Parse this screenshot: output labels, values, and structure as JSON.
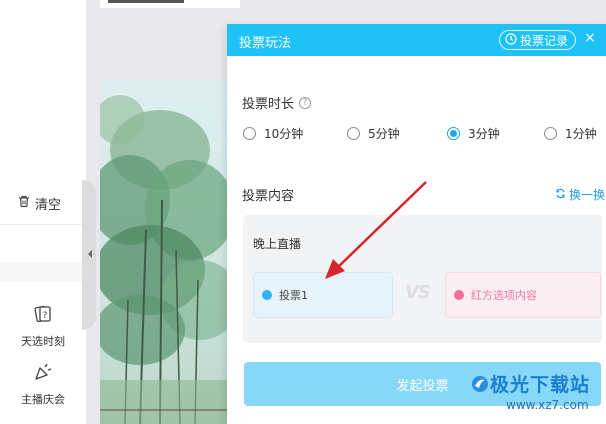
{
  "sidebar": {
    "clear_label": "清空",
    "tools": [
      {
        "label": "天选时刻",
        "icon": "lucky-card-icon"
      },
      {
        "label": "主播庆会",
        "icon": "party-popper-icon"
      }
    ]
  },
  "dialog": {
    "title": "投票玩法",
    "record_label": "投票记录",
    "close_label": "×",
    "duration_label": "投票时长",
    "help_glyph": "?",
    "durations": [
      {
        "label": "10分钟",
        "selected": false
      },
      {
        "label": "5分钟",
        "selected": false
      },
      {
        "label": "3分钟",
        "selected": true
      },
      {
        "label": "1分钟",
        "selected": false
      }
    ],
    "content_label": "投票内容",
    "swap_label": "换一换",
    "topic": "晚上直播",
    "option_left": "投票1",
    "vs": "VS",
    "option_right_placeholder": "红方选项内容",
    "start_label": "发起投票"
  },
  "watermark": {
    "name": "极光下载站",
    "url": "www.xz7.com"
  },
  "colors": {
    "header": "#1ec2f6",
    "accent": "#1aa8e6",
    "arrow": "#d6252b",
    "start_button": "#86d7f8"
  }
}
